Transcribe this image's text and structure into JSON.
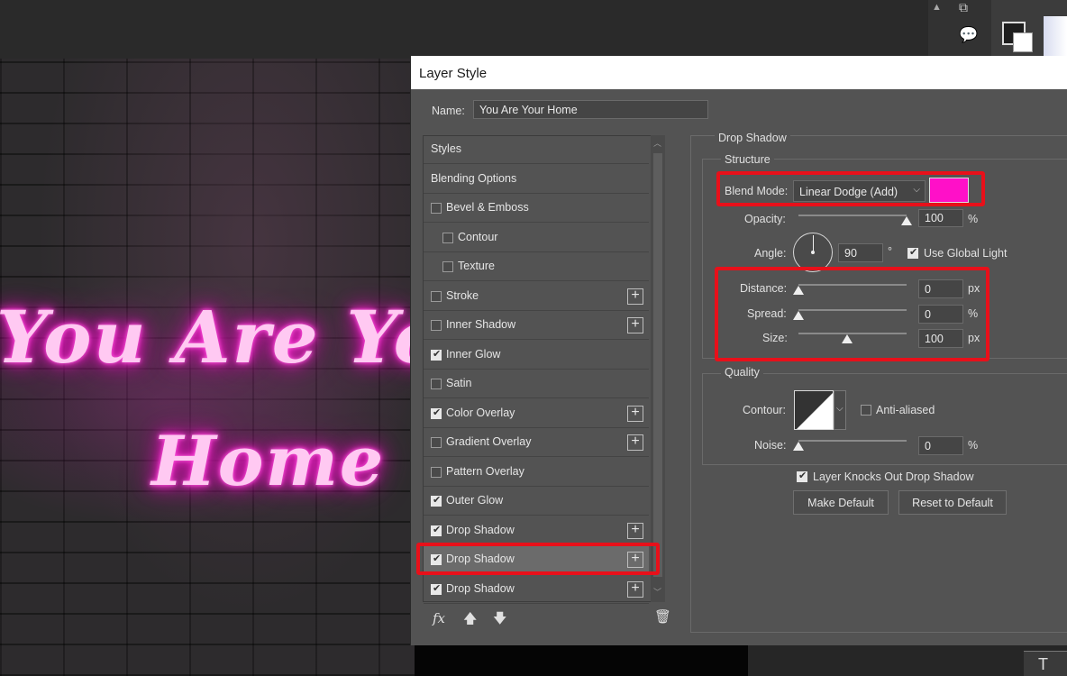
{
  "canvas": {
    "neon_line1": "You Are Yo",
    "neon_line2": "Home"
  },
  "dialog": {
    "title": "Layer Style",
    "name_label": "Name:",
    "name_value": "You Are Your  Home"
  },
  "styles_list": {
    "items": [
      {
        "label": "Styles",
        "checkbox": false,
        "checked": false,
        "plus": false,
        "indent": false
      },
      {
        "label": "Blending Options",
        "checkbox": false,
        "checked": false,
        "plus": false,
        "indent": false
      },
      {
        "label": "Bevel & Emboss",
        "checkbox": true,
        "checked": false,
        "plus": false,
        "indent": false
      },
      {
        "label": "Contour",
        "checkbox": true,
        "checked": false,
        "plus": false,
        "indent": true
      },
      {
        "label": "Texture",
        "checkbox": true,
        "checked": false,
        "plus": false,
        "indent": true
      },
      {
        "label": "Stroke",
        "checkbox": true,
        "checked": false,
        "plus": true,
        "indent": false
      },
      {
        "label": "Inner Shadow",
        "checkbox": true,
        "checked": false,
        "plus": true,
        "indent": false
      },
      {
        "label": "Inner Glow",
        "checkbox": true,
        "checked": true,
        "plus": false,
        "indent": false
      },
      {
        "label": "Satin",
        "checkbox": true,
        "checked": false,
        "plus": false,
        "indent": false
      },
      {
        "label": "Color Overlay",
        "checkbox": true,
        "checked": true,
        "plus": true,
        "indent": false
      },
      {
        "label": "Gradient Overlay",
        "checkbox": true,
        "checked": false,
        "plus": true,
        "indent": false
      },
      {
        "label": "Pattern Overlay",
        "checkbox": true,
        "checked": false,
        "plus": false,
        "indent": false
      },
      {
        "label": "Outer Glow",
        "checkbox": true,
        "checked": true,
        "plus": false,
        "indent": false
      },
      {
        "label": "Drop Shadow",
        "checkbox": true,
        "checked": true,
        "plus": true,
        "indent": false
      },
      {
        "label": "Drop Shadow",
        "checkbox": true,
        "checked": true,
        "plus": true,
        "indent": false,
        "selected": true
      },
      {
        "label": "Drop Shadow",
        "checkbox": true,
        "checked": true,
        "plus": true,
        "indent": false
      }
    ],
    "fx_label": "fx"
  },
  "drop_shadow": {
    "section_title": "Drop Shadow",
    "structure_title": "Structure",
    "blend_mode_label": "Blend Mode:",
    "blend_mode_value": "Linear Dodge (Add)",
    "shadow_color": "#ff10c8",
    "opacity_label": "Opacity:",
    "opacity_value": "100",
    "opacity_unit": "%",
    "angle_label": "Angle:",
    "angle_value": "90",
    "angle_unit": "°",
    "use_global_light_label": "Use Global Light",
    "use_global_light_checked": true,
    "distance_label": "Distance:",
    "distance_value": "0",
    "distance_unit": "px",
    "spread_label": "Spread:",
    "spread_value": "0",
    "spread_unit": "%",
    "size_label": "Size:",
    "size_value": "100",
    "size_unit": "px",
    "quality_title": "Quality",
    "contour_label": "Contour:",
    "anti_aliased_label": "Anti-aliased",
    "anti_aliased_checked": false,
    "noise_label": "Noise:",
    "noise_value": "0",
    "noise_unit": "%",
    "layer_knocks_out_label": "Layer Knocks Out Drop Shadow",
    "layer_knocks_out_checked": true,
    "make_default_label": "Make Default",
    "reset_default_label": "Reset to Default",
    "opacity_level": 100,
    "size_level": 0.45
  },
  "colors": {
    "highlight_red": "#e8101a",
    "dialog_bg": "#535353",
    "neon_pink": "#ff2bd2"
  }
}
